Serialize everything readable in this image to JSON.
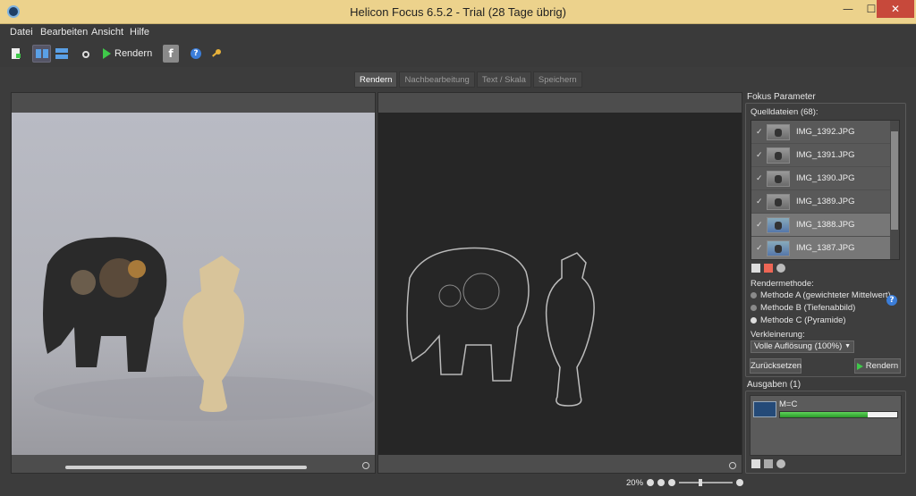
{
  "window": {
    "title": "Helicon Focus 6.5.2 - Trial (28 Tage übrig)",
    "min": "—",
    "max": "☐",
    "close": "✕"
  },
  "menu": [
    "Datei",
    "Bearbeiten",
    "Ansicht",
    "Hilfe"
  ],
  "toolbar": {
    "render_label": "Rendern"
  },
  "tabs": [
    {
      "label": "Rendern",
      "active": true
    },
    {
      "label": "Nachbearbeitung"
    },
    {
      "label": "Text / Skala"
    },
    {
      "label": "Speichern"
    }
  ],
  "panel": {
    "title": "Fokus Parameter",
    "source_label": "Quelldateien (68):",
    "files": [
      {
        "name": "IMG_1392.JPG",
        "checked": true
      },
      {
        "name": "IMG_1391.JPG",
        "checked": true
      },
      {
        "name": "IMG_1390.JPG",
        "checked": true
      },
      {
        "name": "IMG_1389.JPG",
        "checked": true
      },
      {
        "name": "IMG_1388.JPG",
        "checked": true,
        "selected": true
      },
      {
        "name": "IMG_1387.JPG",
        "checked": true,
        "selected": true
      }
    ],
    "render_method_label": "Rendermethode:",
    "methods": [
      {
        "label": "Methode A (gewichteter Mittelwert)",
        "selected": false
      },
      {
        "label": "Methode B (Tiefenabbild)",
        "selected": false
      },
      {
        "label": "Methode C (Pyramide)",
        "selected": true
      }
    ],
    "downscale_label": "Verkleinerung:",
    "downscale_value": "Volle Auflösung (100%)",
    "reset_label": "Zurücksetzen",
    "render_label": "Rendern"
  },
  "outputs": {
    "title": "Ausgaben (1)",
    "items": [
      {
        "label": "M=C",
        "progress": 0.75
      }
    ]
  },
  "status": {
    "zoom": "20%"
  },
  "colors": {
    "titlebar": "#ecd28c",
    "progress": "#2fae2c",
    "close": "#c7493b"
  }
}
